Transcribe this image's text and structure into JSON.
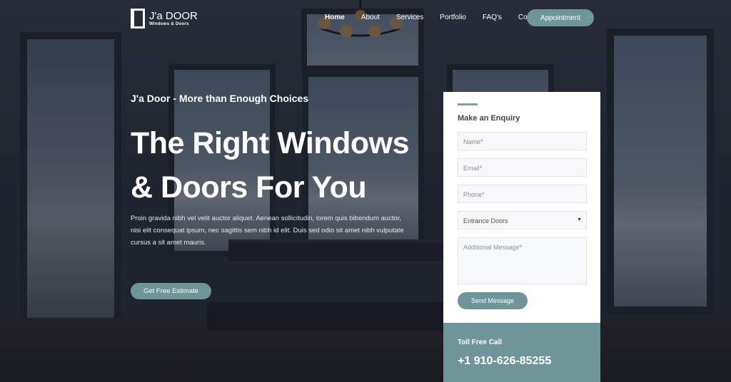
{
  "header": {
    "logo_title": "J'a DOOR",
    "logo_subtitle": "Windows & Doors",
    "nav": [
      "Home",
      "About",
      "Services",
      "Portfolio",
      "FAQ's",
      "Contact"
    ],
    "appointment_label": "Appointment"
  },
  "hero": {
    "tagline": "J'a Door - More than Enough Choices",
    "heading_line1": "The Right Windows",
    "heading_line2": "& Doors For You",
    "description": "Proin gravida nibh vel velit auctor aliquet. Aenean sollicitudin, lorem quis bibendum auctor, nisi elit consequat ipsum, nec sagittis sem nibh id elit. Duis sed odio sit amet nibh vulputate cursus a sit amet mauris.",
    "cta_label": "Get Free Estimate"
  },
  "enquiry": {
    "title": "Make an Enquiry",
    "name_placeholder": "Name*",
    "email_placeholder": "Email*",
    "phone_placeholder": "Phone*",
    "select_value": "Entrance Doors",
    "message_placeholder": "Additional Message*",
    "send_label": "Send Message"
  },
  "toll_free": {
    "label": "Toll Free Call",
    "number": "+1 910-626-85255"
  },
  "colors": {
    "accent": "#6e9597",
    "heading_dark": "#3d4658"
  }
}
